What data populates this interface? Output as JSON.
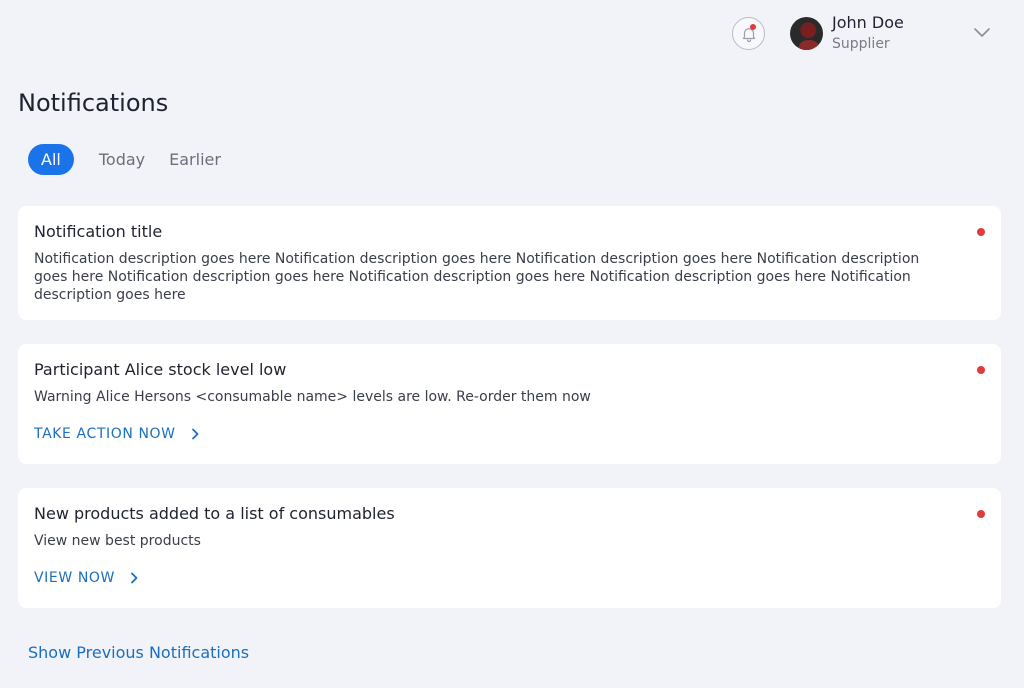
{
  "header": {
    "user_name": "John Doe",
    "user_role": "Supplier",
    "icons": {
      "notifications": "bell-icon",
      "menu": "chevron-down-icon"
    }
  },
  "page": {
    "title": "Notifications"
  },
  "tabs": [
    {
      "label": "All",
      "active": true
    },
    {
      "label": "Today",
      "active": false
    },
    {
      "label": "Earlier",
      "active": false
    }
  ],
  "notifications": [
    {
      "title": "Notification title",
      "description": "Notification description goes here Notification description goes here Notification description goes here Notification description goes here Notification description goes here Notification description goes here Notification description goes here Notification description goes here",
      "unread": true
    },
    {
      "title": "Participant Alice stock level low",
      "description": "Warning Alice Hersons <consumable name> levels are low. Re-order them now",
      "action": "TAKE ACTION NOW",
      "unread": true
    },
    {
      "title": "New products added to a list of consumables",
      "description": "View new best products",
      "action": "VIEW NOW",
      "unread": true
    }
  ],
  "footer": {
    "show_previous": "Show Previous Notifications"
  },
  "colors": {
    "accent": "#1a73e8",
    "link": "#1b6fbd",
    "unread": "#e23b3b",
    "background": "#f2f3f9"
  }
}
